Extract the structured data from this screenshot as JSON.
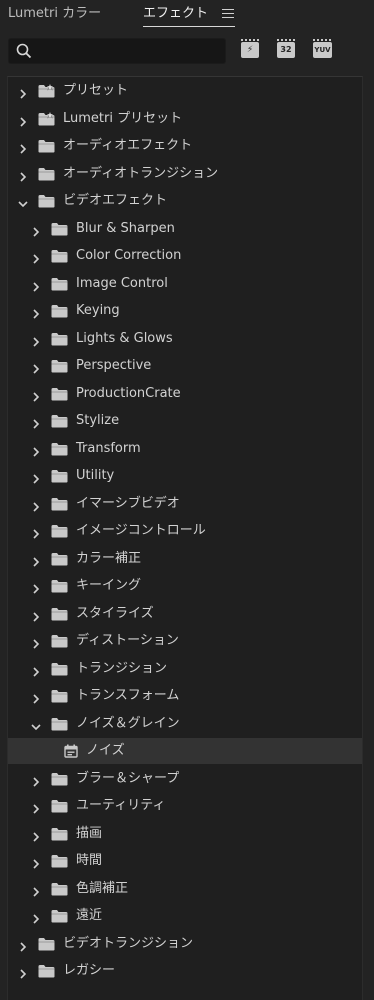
{
  "tabs": {
    "lumetri": "Lumetri カラー",
    "effects": "エフェクト"
  },
  "search": {
    "value": "",
    "placeholder": ""
  },
  "filters": {
    "accelerated": "⚡",
    "bit32": "32",
    "yuv": "YUV"
  },
  "tree": [
    {
      "label": "プリセット",
      "level": 0,
      "expanded": false,
      "icon": "preset-folder-icon"
    },
    {
      "label": "Lumetri プリセット",
      "level": 0,
      "expanded": false,
      "icon": "preset-folder-icon"
    },
    {
      "label": "オーディオエフェクト",
      "level": 0,
      "expanded": false,
      "icon": "folder-icon"
    },
    {
      "label": "オーディオトランジション",
      "level": 0,
      "expanded": false,
      "icon": "folder-icon"
    },
    {
      "label": "ビデオエフェクト",
      "level": 0,
      "expanded": true,
      "icon": "folder-icon"
    },
    {
      "label": "Blur & Sharpen",
      "level": 1,
      "expanded": false,
      "icon": "folder-icon"
    },
    {
      "label": "Color Correction",
      "level": 1,
      "expanded": false,
      "icon": "folder-icon"
    },
    {
      "label": "Image Control",
      "level": 1,
      "expanded": false,
      "icon": "folder-icon"
    },
    {
      "label": "Keying",
      "level": 1,
      "expanded": false,
      "icon": "folder-icon"
    },
    {
      "label": "Lights & Glows",
      "level": 1,
      "expanded": false,
      "icon": "folder-icon"
    },
    {
      "label": "Perspective",
      "level": 1,
      "expanded": false,
      "icon": "folder-icon"
    },
    {
      "label": "ProductionCrate",
      "level": 1,
      "expanded": false,
      "icon": "folder-icon"
    },
    {
      "label": "Stylize",
      "level": 1,
      "expanded": false,
      "icon": "folder-icon"
    },
    {
      "label": "Transform",
      "level": 1,
      "expanded": false,
      "icon": "folder-icon"
    },
    {
      "label": "Utility",
      "level": 1,
      "expanded": false,
      "icon": "folder-icon"
    },
    {
      "label": "イマーシブビデオ",
      "level": 1,
      "expanded": false,
      "icon": "folder-icon"
    },
    {
      "label": "イメージコントロール",
      "level": 1,
      "expanded": false,
      "icon": "folder-icon"
    },
    {
      "label": "カラー補正",
      "level": 1,
      "expanded": false,
      "icon": "folder-icon"
    },
    {
      "label": "キーイング",
      "level": 1,
      "expanded": false,
      "icon": "folder-icon"
    },
    {
      "label": "スタイライズ",
      "level": 1,
      "expanded": false,
      "icon": "folder-icon"
    },
    {
      "label": "ディストーション",
      "level": 1,
      "expanded": false,
      "icon": "folder-icon"
    },
    {
      "label": "トランジション",
      "level": 1,
      "expanded": false,
      "icon": "folder-icon"
    },
    {
      "label": "トランスフォーム",
      "level": 1,
      "expanded": false,
      "icon": "folder-icon"
    },
    {
      "label": "ノイズ＆グレイン",
      "level": 1,
      "expanded": true,
      "icon": "folder-icon"
    },
    {
      "label": "ノイズ",
      "level": 2,
      "expanded": false,
      "icon": "effect-icon",
      "selected": true
    },
    {
      "label": "ブラー＆シャープ",
      "level": 1,
      "expanded": false,
      "icon": "folder-icon"
    },
    {
      "label": "ユーティリティ",
      "level": 1,
      "expanded": false,
      "icon": "folder-icon"
    },
    {
      "label": "描画",
      "level": 1,
      "expanded": false,
      "icon": "folder-icon"
    },
    {
      "label": "時間",
      "level": 1,
      "expanded": false,
      "icon": "folder-icon"
    },
    {
      "label": "色調補正",
      "level": 1,
      "expanded": false,
      "icon": "folder-icon"
    },
    {
      "label": "遠近",
      "level": 1,
      "expanded": false,
      "icon": "folder-icon"
    },
    {
      "label": "ビデオトランジション",
      "level": 0,
      "expanded": false,
      "icon": "folder-icon"
    },
    {
      "label": "レガシー",
      "level": 0,
      "expanded": false,
      "icon": "folder-icon"
    }
  ],
  "colors": {
    "background": "#232323",
    "panel": "#1f1f1f",
    "selected_row": "#333333",
    "text": "#d2d2d2",
    "icon": "#c9c9c9"
  }
}
